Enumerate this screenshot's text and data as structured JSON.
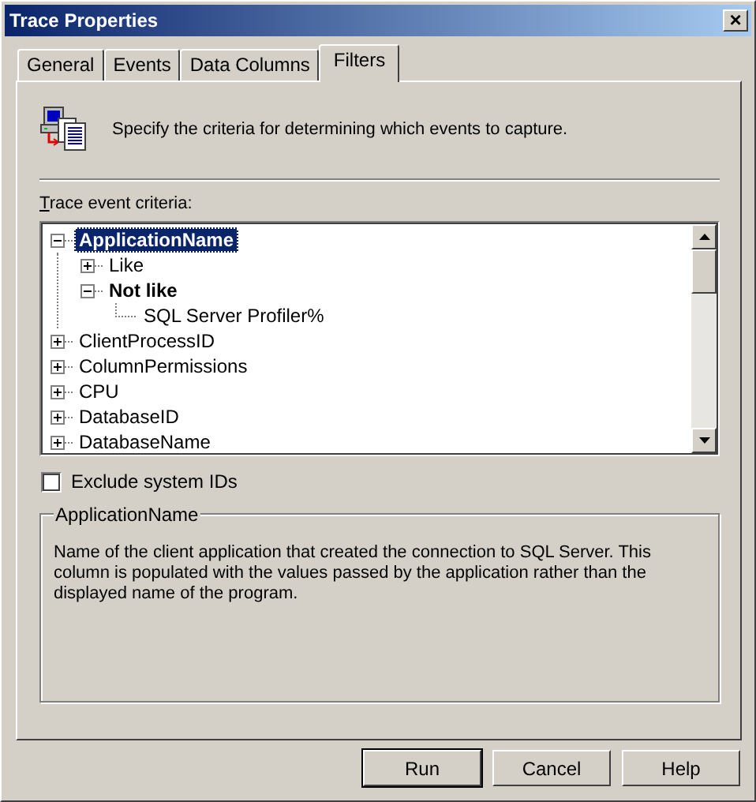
{
  "window": {
    "title": "Trace Properties",
    "close": "×"
  },
  "tabs": [
    {
      "label": "General",
      "selected": false
    },
    {
      "label": "Events",
      "selected": false
    },
    {
      "label": "Data Columns",
      "selected": false
    },
    {
      "label": "Filters",
      "selected": true
    }
  ],
  "intro": "Specify the criteria for determining which events to capture.",
  "criteria_label": "Trace event criteria:",
  "tree": [
    {
      "label": "ApplicationName",
      "kind": "group",
      "expanded": true,
      "selected": true,
      "bold": true,
      "children": [
        {
          "label": "Like",
          "kind": "group",
          "expanded": false,
          "selected": false,
          "bold": false
        },
        {
          "label": "Not like",
          "kind": "group",
          "expanded": true,
          "selected": false,
          "bold": true,
          "children": [
            {
              "label": "SQL Server Profiler%",
              "kind": "value",
              "selected": false,
              "bold": false
            }
          ]
        }
      ]
    },
    {
      "label": "ClientProcessID",
      "kind": "group",
      "expanded": false,
      "selected": false,
      "bold": false
    },
    {
      "label": "ColumnPermissions",
      "kind": "group",
      "expanded": false,
      "selected": false,
      "bold": false
    },
    {
      "label": "CPU",
      "kind": "group",
      "expanded": false,
      "selected": false,
      "bold": false
    },
    {
      "label": "DatabaseID",
      "kind": "group",
      "expanded": false,
      "selected": false,
      "bold": false
    },
    {
      "label": "DatabaseName",
      "kind": "group",
      "expanded": false,
      "selected": false,
      "bold": false
    }
  ],
  "exclude_system_ids": {
    "label": "Exclude system IDs",
    "checked": false
  },
  "description": {
    "title": "ApplicationName",
    "text": "Name of the client application that created the connection to SQL Server. This column is populated with the values passed by the application rather than the displayed name of the program."
  },
  "buttons": [
    {
      "label": "Run",
      "default": true
    },
    {
      "label": "Cancel",
      "default": false
    },
    {
      "label": "Help",
      "default": false
    }
  ]
}
